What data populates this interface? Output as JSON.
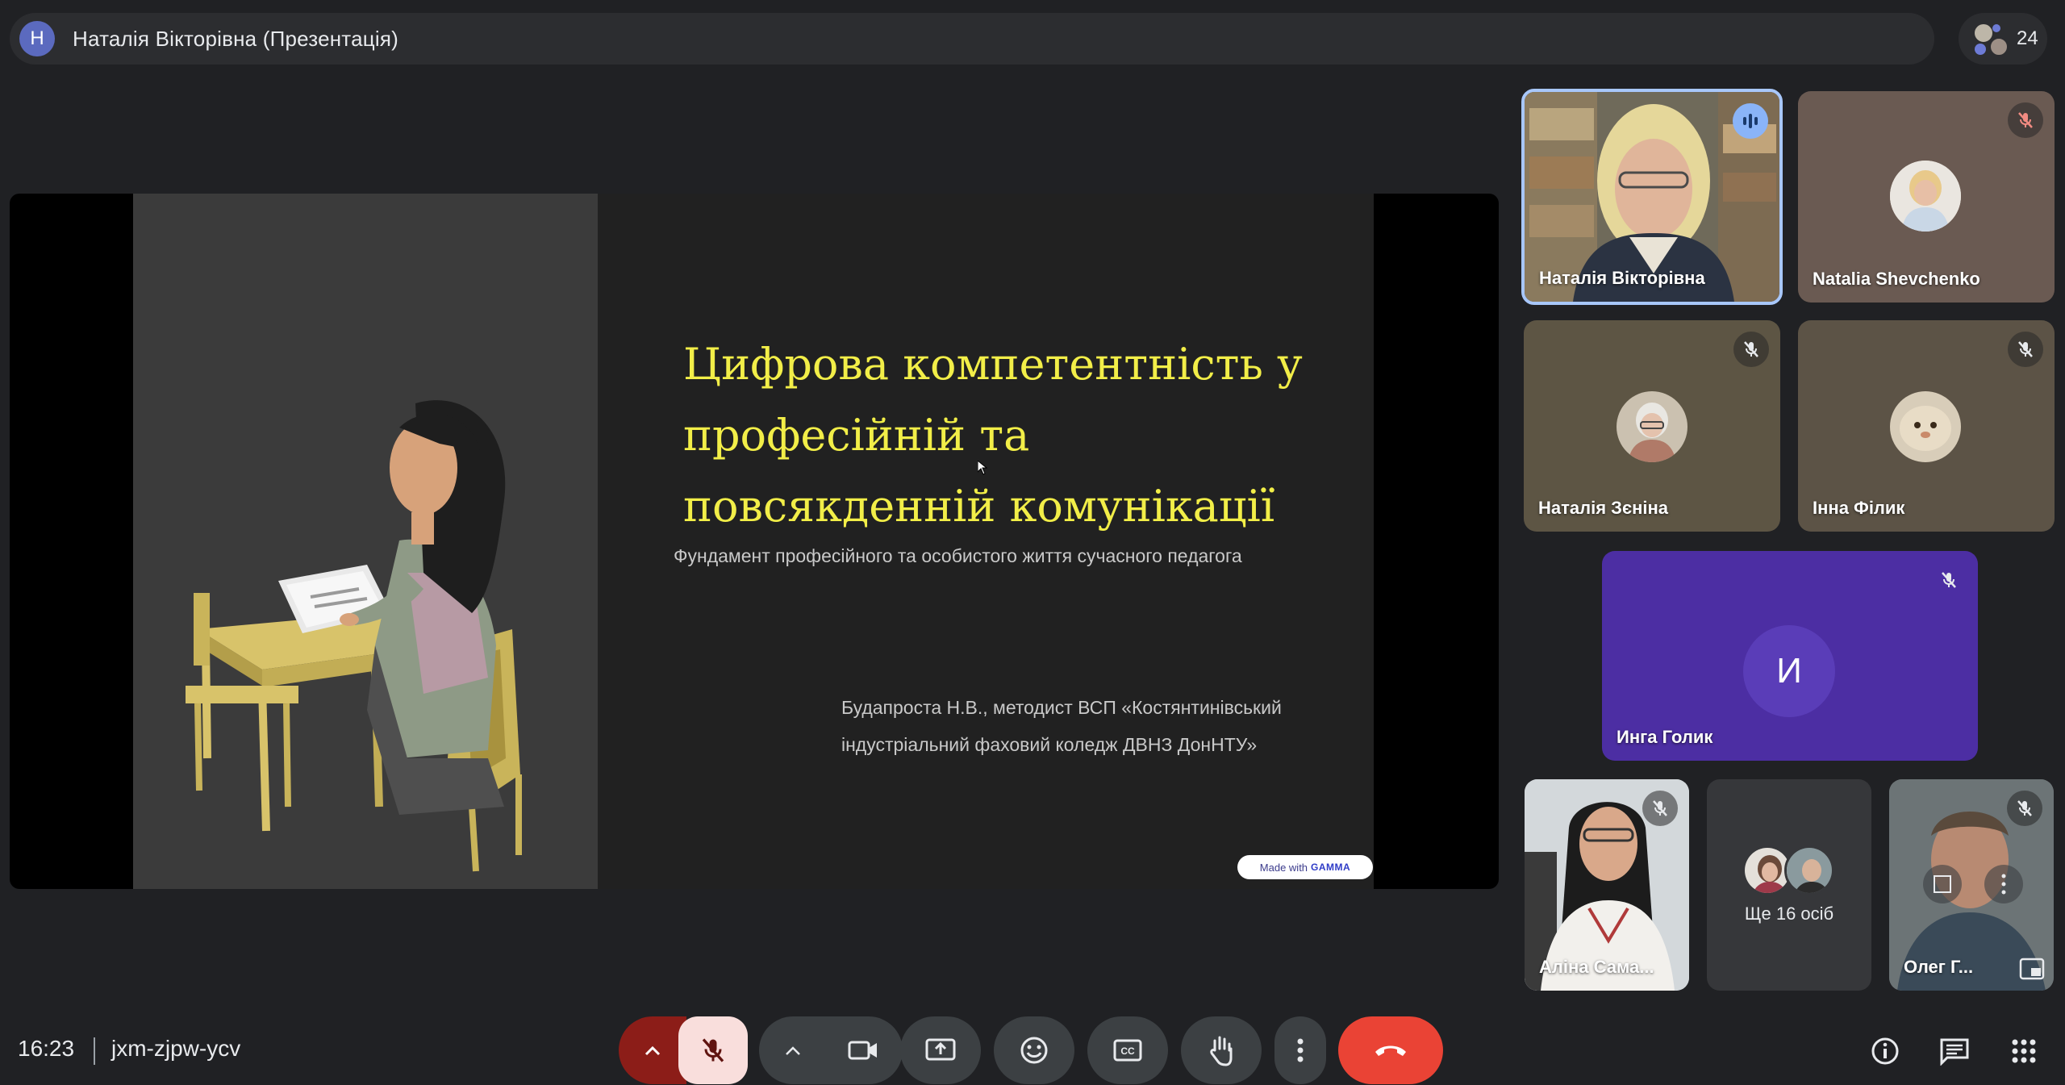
{
  "header": {
    "presenter_initial": "Н",
    "title": "Наталія Вікторівна (Презентація)",
    "participant_count": "24"
  },
  "slide": {
    "title": "Цифрова компетентність у професійній та повсякденній комунікації",
    "subtitle": "Фундамент професійного та особистого життя сучасного педагога",
    "author_line1": "Будапроста Н.В., методист  ВСП «Костянтинівський",
    "author_line2": "індустріальний фаховий коледж ДВНЗ ДонНТУ»",
    "badge_prefix": "Made with",
    "badge_brand": "GAMMA"
  },
  "tiles": [
    {
      "name": "Наталія Вікторівна",
      "state": "speaking"
    },
    {
      "name": "Natalia Shevchenko",
      "state": "muted"
    },
    {
      "name": "Наталія Зєніна",
      "state": "muted"
    },
    {
      "name": "Інна Філик",
      "state": "muted"
    },
    {
      "name": "Инга Голик",
      "initial": "И",
      "state": "muted"
    },
    {
      "name": "Аліна Сама...",
      "state": "muted"
    },
    {
      "name": "Ще 16 осіб",
      "state": "overflow"
    },
    {
      "name": "Олег Г...",
      "state": "muted"
    }
  ],
  "footer": {
    "time": "16:23",
    "meeting_code": "jxm-zjpw-ycv"
  },
  "colors": {
    "background": "#202124",
    "slide_title": "#f2ee48",
    "speaking_border": "#a8c7fa",
    "leave_button": "#ea4335",
    "mic_muted_bg": "#f9dedc"
  },
  "icons": [
    "mic-off-icon",
    "video-camera-icon",
    "present-screen-icon",
    "emoji-icon",
    "captions-icon",
    "raise-hand-icon",
    "more-vert-icon",
    "call-end-icon",
    "info-icon",
    "chat-icon",
    "apps-grid-icon"
  ]
}
